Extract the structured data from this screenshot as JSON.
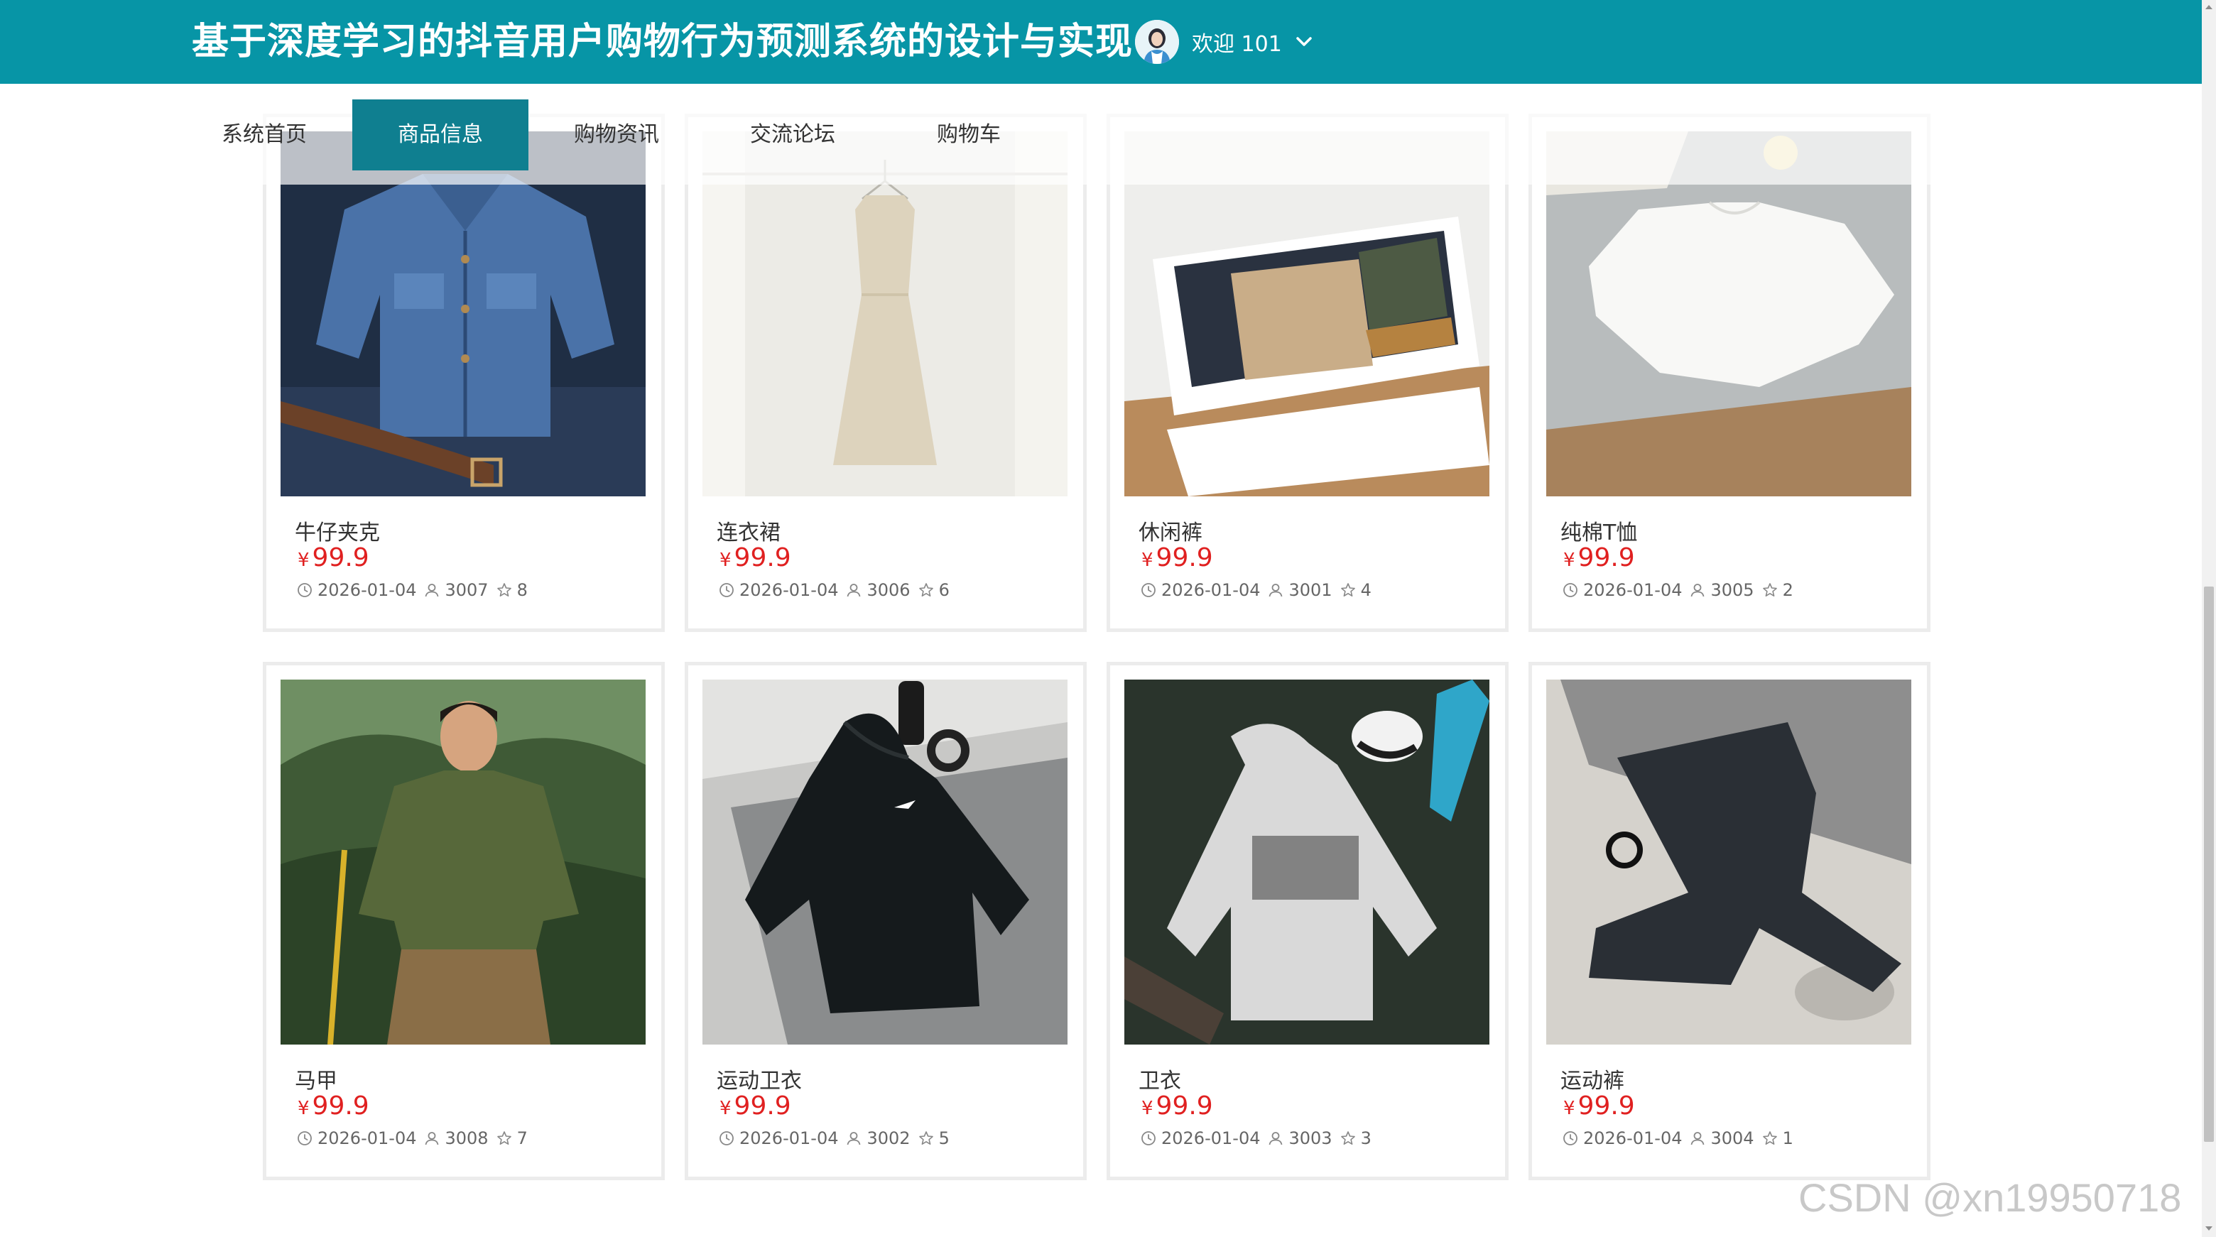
{
  "header": {
    "title": "基于深度学习的抖音用户购物行为预测系统的设计与实现",
    "welcome": "欢迎 101",
    "brand_color": "#0795a6"
  },
  "nav": {
    "items": [
      {
        "label": "系统首页",
        "active": false
      },
      {
        "label": "商品信息",
        "active": true
      },
      {
        "label": "购物资讯",
        "active": false
      },
      {
        "label": "交流论坛",
        "active": false
      },
      {
        "label": "购物车",
        "active": false
      }
    ],
    "active_color": "#0f7f90"
  },
  "products": [
    {
      "name": "牛仔夹克",
      "currency": "¥",
      "price": "99.9",
      "date": "2026-01-04",
      "user": "3007",
      "favorites": "8",
      "image": "denim-jacket"
    },
    {
      "name": "连衣裙",
      "currency": "¥",
      "price": "99.9",
      "date": "2026-01-04",
      "user": "3006",
      "favorites": "6",
      "image": "dress"
    },
    {
      "name": "休闲裤",
      "currency": "¥",
      "price": "99.9",
      "date": "2026-01-04",
      "user": "3001",
      "favorites": "4",
      "image": "casual-pants-drawer"
    },
    {
      "name": "纯棉T恤",
      "currency": "¥",
      "price": "99.9",
      "date": "2026-01-04",
      "user": "3005",
      "favorites": "2",
      "image": "white-tshirt"
    },
    {
      "name": "马甲",
      "currency": "¥",
      "price": "99.9",
      "date": "2026-01-04",
      "user": "3008",
      "favorites": "7",
      "image": "man-in-vest"
    },
    {
      "name": "运动卫衣",
      "currency": "¥",
      "price": "99.9",
      "date": "2026-01-04",
      "user": "3002",
      "favorites": "5",
      "image": "black-hoodie"
    },
    {
      "name": "卫衣",
      "currency": "¥",
      "price": "99.9",
      "date": "2026-01-04",
      "user": "3003",
      "favorites": "3",
      "image": "grey-hoodie"
    },
    {
      "name": "运动裤",
      "currency": "¥",
      "price": "99.9",
      "date": "2026-01-04",
      "user": "3004",
      "favorites": "1",
      "image": "sport-pants"
    }
  ],
  "price_color": "#e02020",
  "watermark": "CSDN @xn19950718"
}
